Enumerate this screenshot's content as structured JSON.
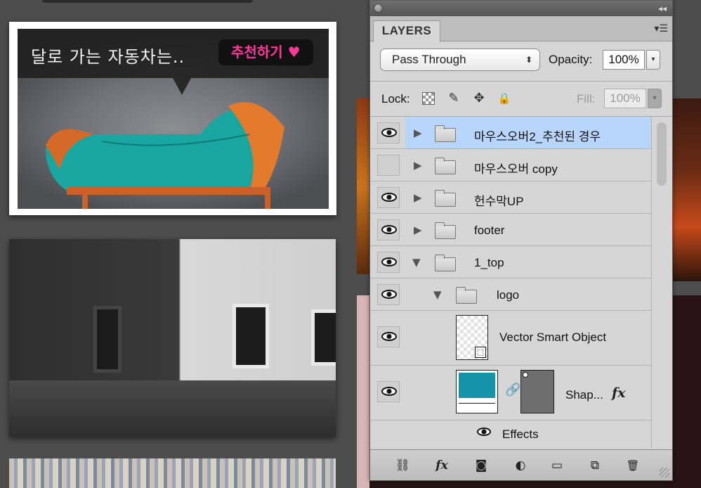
{
  "canvas": {
    "banner_text": "달로 가는 자동차는..",
    "recommend_button": "추천하기 ♥"
  },
  "panel": {
    "tab_label": "LAYERS",
    "collapse_icon": "◂◂",
    "menu_icon": "▾☰",
    "blend_mode": "Pass Through",
    "blend_arrows": "⬍",
    "opacity_label": "Opacity:",
    "opacity_value": "100%",
    "opacity_dropdown": "▾",
    "lock_label": "Lock:",
    "lock_icons": {
      "paint": "✎",
      "move": "✥",
      "all": "🔒"
    },
    "fill_label": "Fill:",
    "fill_value": "100%",
    "fill_dropdown": "▾"
  },
  "layers": [
    {
      "name": "마우스오버2_추천된 경우",
      "visible": true,
      "expanded": false,
      "selected": true,
      "type": "group"
    },
    {
      "name": "마우스오버 copy",
      "visible": false,
      "expanded": false,
      "selected": false,
      "type": "group"
    },
    {
      "name": "헌수막UP",
      "visible": true,
      "expanded": false,
      "selected": false,
      "type": "group"
    },
    {
      "name": "footer",
      "visible": true,
      "expanded": false,
      "selected": false,
      "type": "group"
    },
    {
      "name": "1_top",
      "visible": true,
      "expanded": true,
      "selected": false,
      "type": "group"
    },
    {
      "name": "logo",
      "visible": true,
      "expanded": true,
      "selected": false,
      "type": "group"
    },
    {
      "name": "Vector Smart Object",
      "visible": true,
      "selected": false,
      "type": "smart-object"
    },
    {
      "name": "Shap...",
      "visible": true,
      "selected": false,
      "type": "shape",
      "swatch_color": "#1593a8",
      "fx": "fx"
    },
    {
      "name": "Effects",
      "visible": true,
      "type": "effects"
    }
  ],
  "disclosure": {
    "collapsed": "▶",
    "expanded": "▼"
  },
  "toolbar": {
    "link": "⛓",
    "fx": "fx",
    "mask": "◙",
    "adjustment": "◐",
    "group": "▭",
    "new_layer": "⧉",
    "trash": "🗑"
  },
  "colors": {
    "selected_row": "#b8d5fb",
    "recommend_pink": "#ff3a9a",
    "shape_fill": "#1593a8"
  }
}
